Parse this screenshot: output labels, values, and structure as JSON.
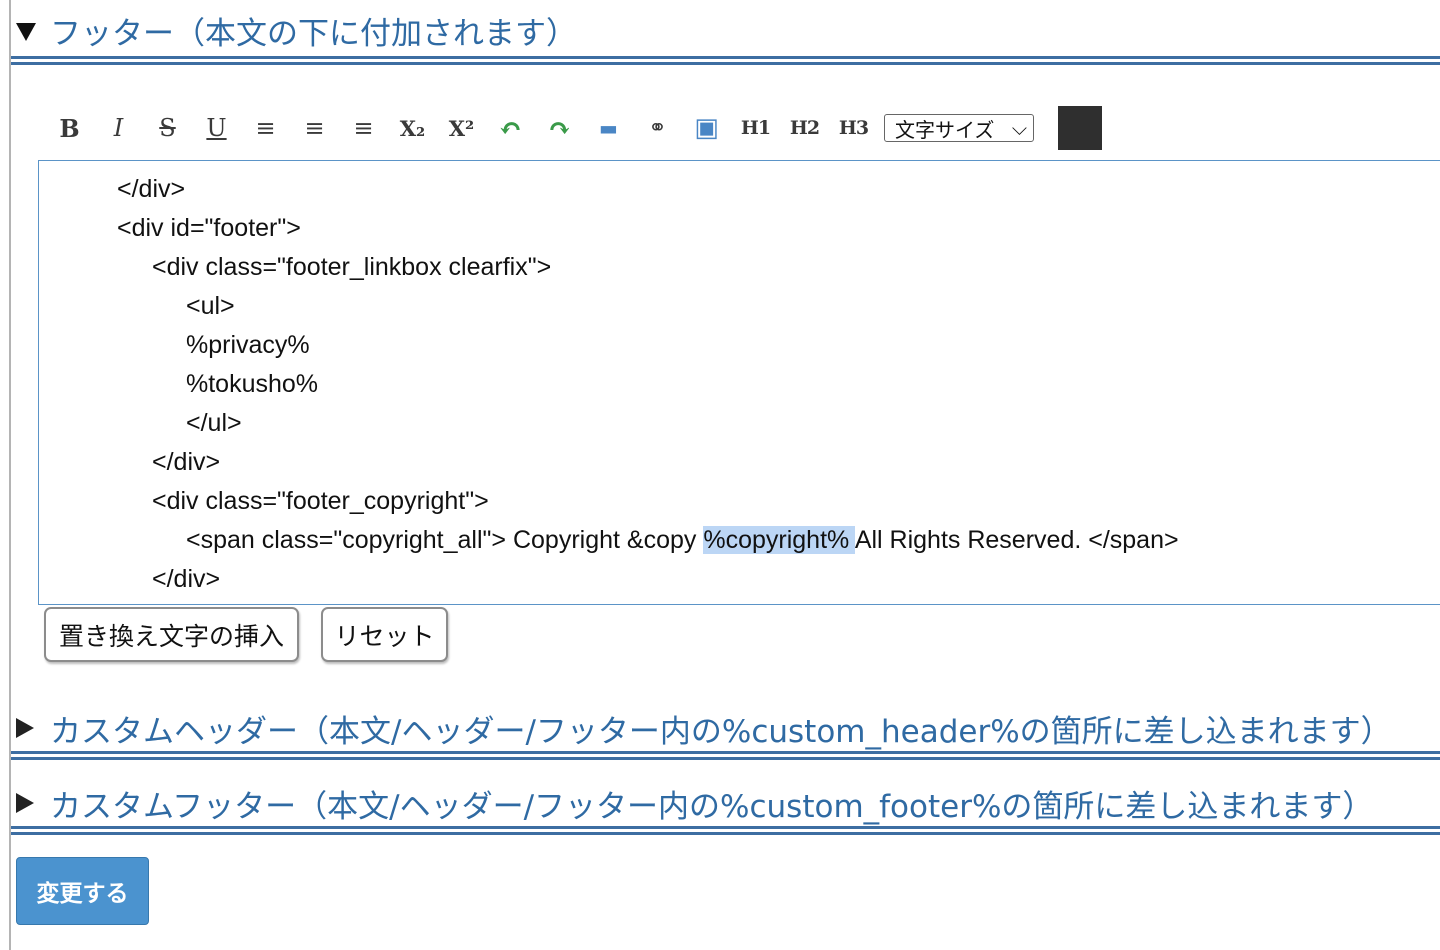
{
  "footer_section": {
    "title": "フッター（本文の下に付加されます）",
    "toolbar": {
      "bold": "B",
      "italic": "I",
      "strike": "S",
      "underline": "U",
      "align_left": "≡",
      "align_center": "≡",
      "align_right": "≡",
      "subscript": "X₂",
      "superscript": "X²",
      "undo": "↶",
      "redo": "↷",
      "hr": "▬",
      "link": "⚭",
      "image": "▣",
      "h1": "H1",
      "h2": "H2",
      "h3": "H3",
      "font_size_select": "文字サイズ",
      "select_chevron": "⌵",
      "color_value": "#2f2f2f"
    },
    "code_lines": [
      "</div>",
      "<div id=\"footer\">",
      "<div class=\"footer_linkbox clearfix\">",
      "<ul>",
      "%privacy%",
      "%tokusho%",
      "</ul>",
      "</div>",
      "<div class=\"footer_copyright\">"
    ],
    "copyright_line": {
      "before": "<span class=\"copyright_all\"> Copyright &copy ",
      "selected": "%copyright% ",
      "after": "All Rights Reserved. </span>"
    },
    "last_line": "</div>",
    "insert_button": "置き換え文字の挿入",
    "reset_button": "リセット"
  },
  "custom_header_section": {
    "title": "カスタムヘッダー（本文/ヘッダー/フッター内の%custom_header%の箇所に差し込まれます）"
  },
  "custom_footer_section": {
    "title": "カスタムフッター（本文/ヘッダー/フッター内の%custom_footer%の箇所に差し込まれます）"
  },
  "submit_button": "変更する",
  "colors": {
    "heading_blue": "#2f6aa3",
    "rule_blue": "#3d6ea2",
    "editor_border": "#5b94c7",
    "selection": "#bcd6f5",
    "submit_bg": "#4b93cf"
  }
}
